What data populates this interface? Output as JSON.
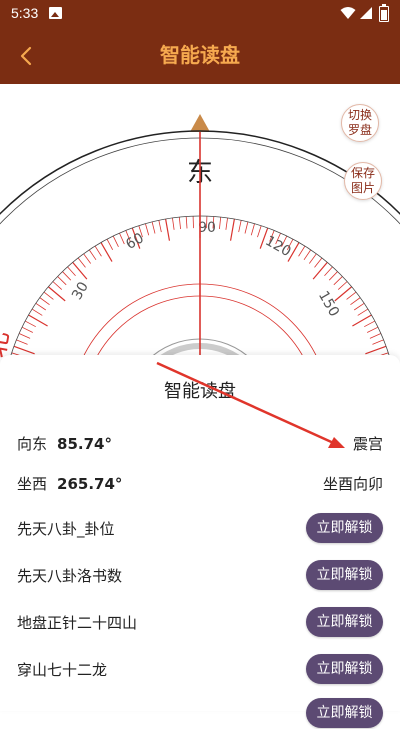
{
  "status": {
    "time": "5:33"
  },
  "appbar": {
    "title": "智能读盘"
  },
  "compass": {
    "direction_char": "东",
    "ticks": [
      "30",
      "60",
      "90",
      "120",
      "150"
    ],
    "partial_char": "北"
  },
  "side_buttons": [
    {
      "label": "切换罗盘"
    },
    {
      "label": "保存图片"
    }
  ],
  "sheet": {
    "title": "智能读盘",
    "facing": {
      "label": "向东",
      "degree": "85.74°",
      "value": "震宫"
    },
    "sitting": {
      "label": "坐西",
      "degree": "265.74°",
      "value": "坐酉向卯"
    },
    "items": [
      {
        "label": "先天八卦_卦位",
        "button": "立即解锁"
      },
      {
        "label": "先天八卦洛书数",
        "button": "立即解锁"
      },
      {
        "label": "地盘正针二十四山",
        "button": "立即解锁"
      },
      {
        "label": "穿山七十二龙",
        "button": "立即解锁"
      },
      {
        "label": "",
        "button": "立即解锁"
      }
    ]
  },
  "colors": {
    "brand": "#7b2d12",
    "title": "#f6a94f",
    "button": "#5c4a73",
    "red": "#d9332e"
  }
}
